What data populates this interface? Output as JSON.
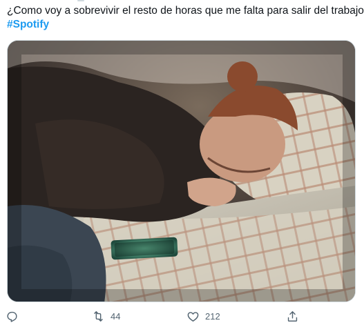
{
  "tweet": {
    "text": "¿Como voy a sobrevivir el resto de horas que me falta para salir del trabajo?",
    "hashtag": "#Spotify"
  },
  "media": {
    "subject": "photo"
  },
  "actions": {
    "reply_icon": "reply-icon",
    "retweet_icon": "retweet-icon",
    "retweet_count": "44",
    "like_icon": "heart-icon",
    "like_count": "212",
    "share_icon": "share-icon"
  },
  "colors": {
    "hashtag": "#1d9bf0",
    "action_gray": "#536471",
    "border": "#cfd9de"
  }
}
